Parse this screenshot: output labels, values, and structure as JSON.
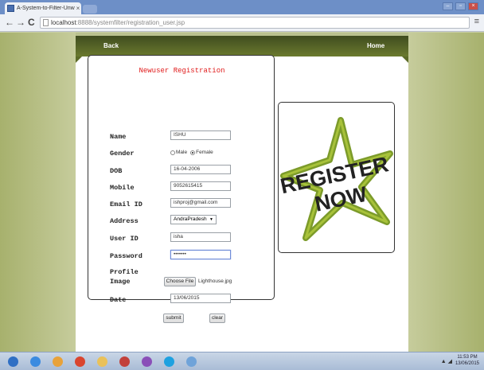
{
  "browser": {
    "tab_title": "A-System-to-Filter-Unwa",
    "tab_close": "×",
    "url_host": "localhost",
    "url_rest": ":8888/systemfilter/registration_user.jsp",
    "back_arrow": "←",
    "forward_arrow": "→",
    "reload": "C",
    "menu": "≡",
    "window_controls": [
      "–",
      "▫",
      "×"
    ]
  },
  "nav": {
    "back": "Back",
    "home": "Home"
  },
  "form": {
    "title": "Newuser Registration",
    "fields": {
      "name": {
        "label": "Name",
        "value": "ISHU"
      },
      "gender": {
        "label": "Gender",
        "option_male": "Male",
        "option_female": "Female",
        "selected": "Female"
      },
      "dob": {
        "label": "DOB",
        "value": "16-04-2006"
      },
      "mobile": {
        "label": "Mobile",
        "value": "9052615415"
      },
      "email": {
        "label": "Email ID",
        "value": "ishproj@gmail.com"
      },
      "address": {
        "label": "Address",
        "value": "AndraPradesh"
      },
      "userid": {
        "label": "User ID",
        "value": "isha"
      },
      "password": {
        "label": "Password",
        "value": "•••••••"
      },
      "profile_image": {
        "label_line1": "Profile",
        "label_line2": "Image",
        "button": "Choose File",
        "file_name": "Lighthouse.jpg"
      },
      "date": {
        "label": "Date",
        "value": "13/06/2015"
      }
    },
    "submit": "submit",
    "clear": "clear"
  },
  "promo": {
    "line1": "REGISTER",
    "line2": "NOW"
  },
  "taskbar": {
    "icons": [
      {
        "name": "start-orb-icon",
        "color": "#2f6fc4"
      },
      {
        "name": "ie-icon",
        "color": "#3b8be0"
      },
      {
        "name": "media-player-icon",
        "color": "#e8a23a"
      },
      {
        "name": "chrome-icon",
        "color": "#d9452f"
      },
      {
        "name": "explorer-folder-icon",
        "color": "#e9c15a"
      },
      {
        "name": "paint-icon",
        "color": "#c2413b"
      },
      {
        "name": "app-icon",
        "color": "#8a4fb8"
      },
      {
        "name": "skype-icon",
        "color": "#1ea1e0"
      },
      {
        "name": "notepad-icon",
        "color": "#6fa3d9"
      }
    ],
    "time": "11:53 PM",
    "date": "13/06/2015"
  }
}
